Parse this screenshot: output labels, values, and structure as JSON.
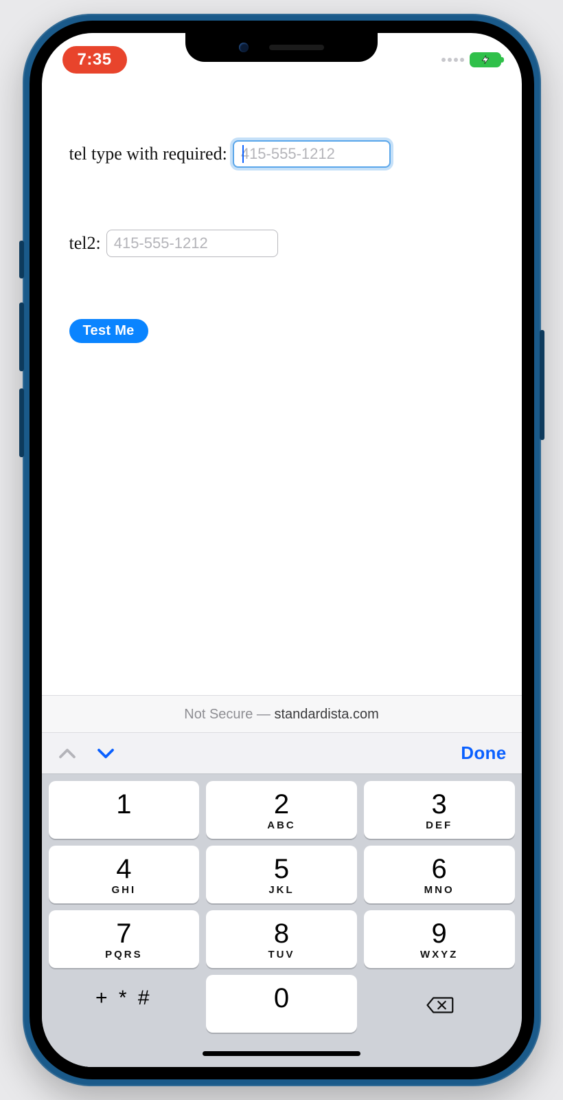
{
  "status": {
    "time": "7:35",
    "colors": {
      "time_pill": "#e8442c",
      "battery": "#30c04a",
      "accent": "#0a84ff",
      "done": "#0a60ff"
    }
  },
  "form": {
    "field1": {
      "label": "tel type with required:",
      "placeholder": "415-555-1212",
      "value": ""
    },
    "field2": {
      "label": "tel2:",
      "placeholder": "415-555-1212",
      "value": ""
    },
    "button": "Test Me"
  },
  "urlbar": {
    "prefix": "Not Secure — ",
    "domain": "standardista.com"
  },
  "kb": {
    "done": "Done",
    "rows": [
      [
        {
          "d": "1",
          "l": ""
        },
        {
          "d": "2",
          "l": "ABC"
        },
        {
          "d": "3",
          "l": "DEF"
        }
      ],
      [
        {
          "d": "4",
          "l": "GHI"
        },
        {
          "d": "5",
          "l": "JKL"
        },
        {
          "d": "6",
          "l": "MNO"
        }
      ],
      [
        {
          "d": "7",
          "l": "PQRS"
        },
        {
          "d": "8",
          "l": "TUV"
        },
        {
          "d": "9",
          "l": "WXYZ"
        }
      ]
    ],
    "symbols": "+ * #",
    "zero": "0"
  }
}
